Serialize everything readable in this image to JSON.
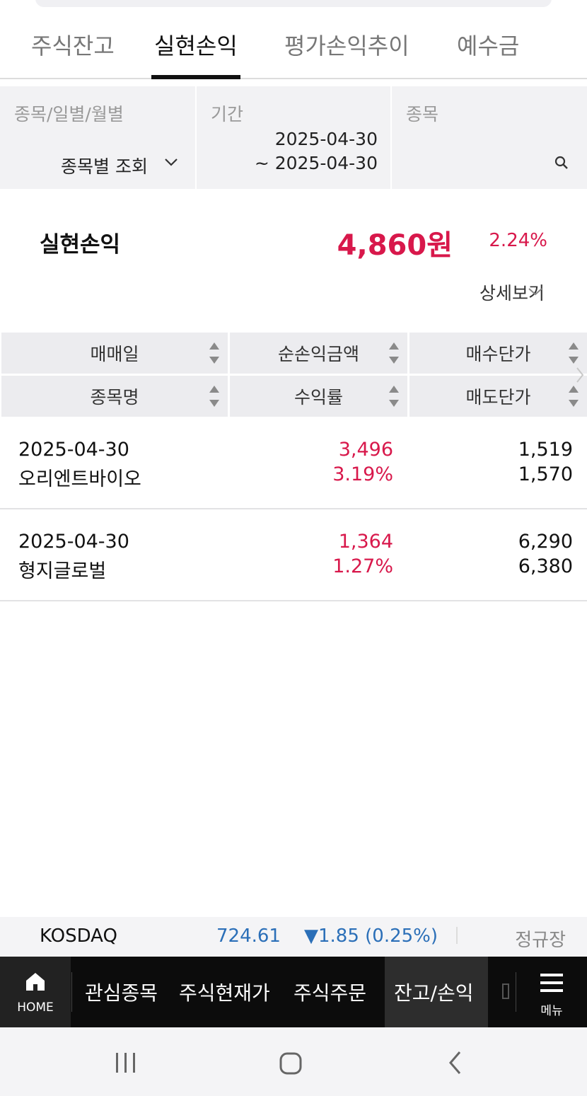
{
  "tabs": [
    {
      "label": "주식잔고"
    },
    {
      "label": "실현손익"
    },
    {
      "label": "평가손익추이"
    },
    {
      "label": "예수금"
    }
  ],
  "filter": {
    "type_label": "종목/일별/월별",
    "type_value": "종목별 조회",
    "period_label": "기간",
    "period_start": "2025-04-30",
    "period_end": "~ 2025-04-30",
    "stock_label": "종목"
  },
  "summary": {
    "label": "실현손익",
    "amount": "4,860원",
    "rate": "2.24%",
    "detail": "상세보기"
  },
  "table": {
    "headers": {
      "trade_date": "매매일",
      "net_profit": "순손익금액",
      "buy_price": "매수단가",
      "stock_name": "종목명",
      "return_rate": "수익률",
      "sell_price": "매도단가"
    },
    "rows": [
      {
        "date": "2025-04-30",
        "name": "오리엔트바이오",
        "profit": "3,496",
        "rate": "3.19%",
        "buy": "1,519",
        "sell": "1,570"
      },
      {
        "date": "2025-04-30",
        "name": "형지글로벌",
        "profit": "1,364",
        "rate": "1.27%",
        "buy": "6,290",
        "sell": "6,380"
      }
    ]
  },
  "ticker": {
    "name": "KOSDAQ",
    "price": "724.61",
    "change": "▼1.85 (0.25%)",
    "session": "정규장"
  },
  "nav": {
    "home": "HOME",
    "items": [
      "관심종목",
      "주식현재가",
      "주식주문",
      "잔고/손익"
    ],
    "menu": "메뉴"
  },
  "colors": {
    "accent_red": "#d8184b",
    "down_blue": "#2b6fb8"
  }
}
